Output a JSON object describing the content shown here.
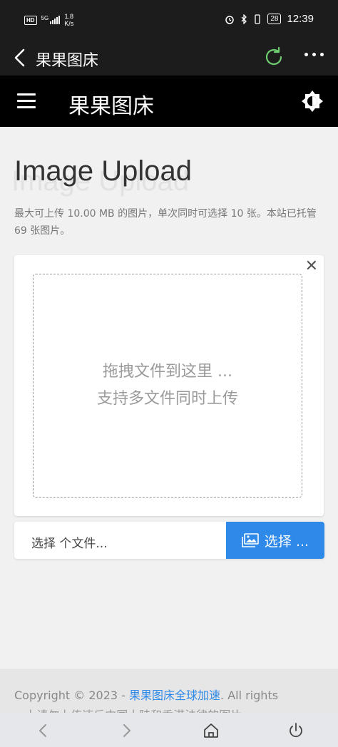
{
  "status_bar": {
    "network_badge": "HD",
    "network_type": "5G",
    "speed_value": "1.8",
    "speed_unit": "K/s",
    "battery": "28",
    "time": "12:39"
  },
  "toolbar": {
    "title": "果果图床"
  },
  "site_header": {
    "title": "果果图床"
  },
  "main": {
    "heading": "Image Upload",
    "description": "最大可上传 10.00 MB 的图片，单次同时可选择 10 张。本站已托管 69 张图片。",
    "dropzone_line1": "拖拽文件到这里 ...",
    "dropzone_line2": "支持多文件同时上传",
    "close_symbol": "✕",
    "file_placeholder": "选择 个文件...",
    "choose_button": "选择 ..."
  },
  "footer": {
    "copyright_prefix": "Copyright © 2023 - ",
    "site_link": "果果图床全球加速",
    "copyright_suffix": ". All rights",
    "notice": "...上请勿上传违反中国大陆和香港法律的图片"
  },
  "colors": {
    "accent": "#2f89e8",
    "refresh_icon": "#6ecf6e"
  },
  "icons": [
    "back-icon",
    "refresh-icon",
    "more-icon",
    "menu-icon",
    "theme-toggle-icon",
    "close-icon",
    "image-icon",
    "nav-back-icon",
    "nav-forward-icon",
    "nav-home-icon",
    "nav-power-icon"
  ]
}
